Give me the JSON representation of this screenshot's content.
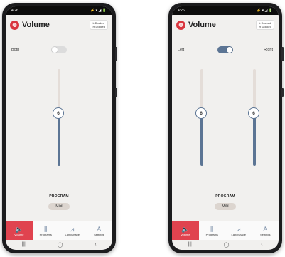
{
  "screens": [
    {
      "status_time": "4:26",
      "status_right": "⚡ ▾ ◢ 🔋",
      "title": "Volume",
      "docked": {
        "left": "L  Docked",
        "right": "R  Docked"
      },
      "toggle_label_left": "Both",
      "toggle_label_right": "",
      "toggle_on": false,
      "sliders": [
        {
          "value": "6",
          "level": 0.55
        }
      ],
      "program_label": "PROGRAM",
      "program_value": "Mild",
      "tabs": [
        {
          "label": "Volume",
          "icon": "speaker-icon",
          "glyph": "🔈"
        },
        {
          "label": "Programs",
          "icon": "waveform-icon",
          "glyph": "⫼"
        },
        {
          "label": "LandShape",
          "icon": "chart-line-icon",
          "glyph": "⩘"
        },
        {
          "label": "Settings",
          "icon": "person-icon",
          "glyph": "♙"
        }
      ],
      "nav": [
        "|||",
        "◯",
        "‹"
      ]
    },
    {
      "status_time": "4:26",
      "status_right": "⚡ ▾ ◢ 🔋",
      "title": "Volume",
      "docked": {
        "left": "L  Docked",
        "right": "R  Docked"
      },
      "toggle_label_left": "Left",
      "toggle_label_right": "Right",
      "toggle_on": true,
      "sliders": [
        {
          "value": "6",
          "level": 0.55
        },
        {
          "value": "6",
          "level": 0.55
        }
      ],
      "program_label": "PROGRAM",
      "program_value": "Mild",
      "tabs": [
        {
          "label": "Volume",
          "icon": "speaker-icon",
          "glyph": "🔈"
        },
        {
          "label": "Programs",
          "icon": "waveform-icon",
          "glyph": "⫼"
        },
        {
          "label": "LandShape",
          "icon": "chart-line-icon",
          "glyph": "⩘"
        },
        {
          "label": "Settings",
          "icon": "person-icon",
          "glyph": "♙"
        }
      ],
      "nav": [
        "|||",
        "◯",
        "‹"
      ]
    }
  ],
  "colors": {
    "accent": "#e0434f",
    "slider": "#5c7594",
    "track": "#e4ddd8",
    "brand": "#d9353e"
  }
}
